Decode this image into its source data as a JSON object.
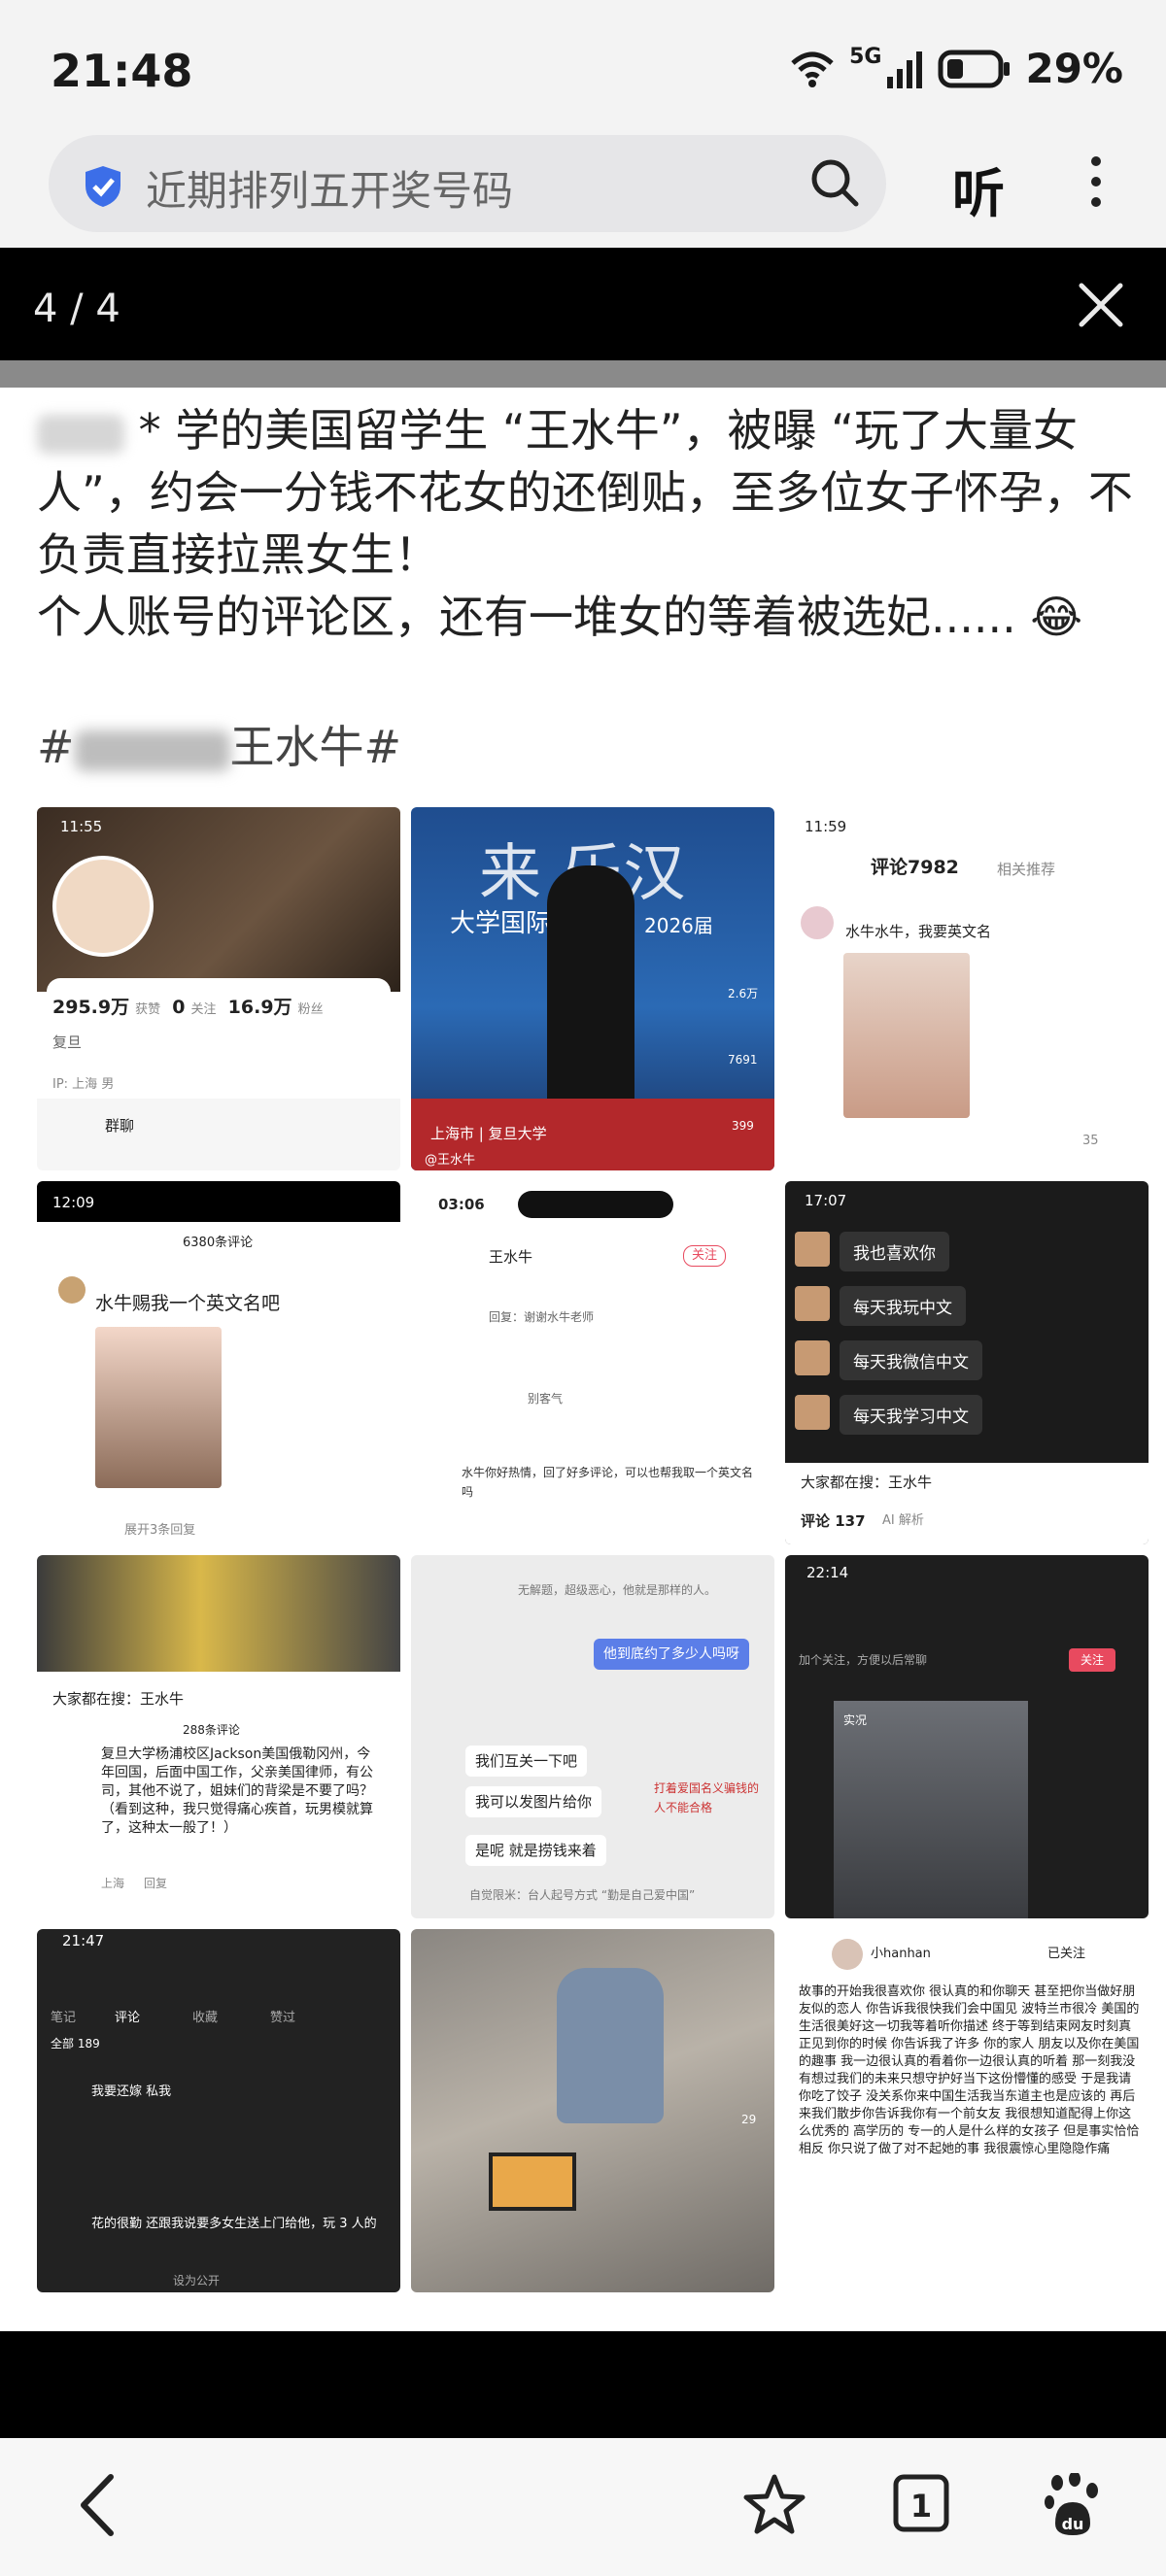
{
  "status_bar": {
    "time": "21:48",
    "network": "5G",
    "battery": "29%"
  },
  "search": {
    "query": "近期排列五开奖号码",
    "listen_label": "听"
  },
  "viewer": {
    "counter": "4 / 4"
  },
  "post": {
    "line1": "学的美国留学生 “王水牛”，被曝 “玩了大量女",
    "line2": "人”，约会一分钱不花女的还倒贴，至多位女子怀孕，不",
    "line3": "负责直接拉黑女生！",
    "line4": "个人账号的评论区，还有一堆女的等着被选妃...... 😂",
    "hashtag_start": "#",
    "hashtag_end": "王水牛#"
  },
  "thumbs": {
    "t1": {
      "time": "11:55",
      "followers": "295.9万",
      "followers_label": "获赞",
      "following": "0",
      "following_label": "关注",
      "fans": "16.9万",
      "fans_label": "粉丝",
      "school": "复旦",
      "location": "IP: 上海   男",
      "group": "群聊"
    },
    "t2": {
      "title": "大学国际文",
      "year": "2026届",
      "likes": "2.6万",
      "comments": "7691",
      "stars": "399",
      "location": "上海市 | 复旦大学",
      "author": "@王水牛"
    },
    "t3": {
      "time": "11:59",
      "tab_comments": "评论7982",
      "tab_related": "相关推荐",
      "comment": "水牛水牛，我要英文名",
      "likes": "35"
    },
    "t4": {
      "time": "12:09",
      "count": "6380条评论",
      "comment": "水牛赐我一个英文名吧",
      "expand": "展开3条回复"
    },
    "t5": {
      "time": "03:06",
      "name": "王水牛",
      "follow": "关注",
      "c1": "回复：谢谢水牛老师",
      "c2": "别客气",
      "c3": "水牛你好热情，回了好多评论，可以也帮我取一个英文名吗"
    },
    "t6": {
      "time": "17:07",
      "m1": "我也喜欢你",
      "m2": "每天我玩中文",
      "m3": "每天我微信中文",
      "m4": "每天我学习中文",
      "search": "大家都在搜：王水牛",
      "comments": "评论 137",
      "ai": "AI 解析"
    },
    "t7": {
      "search": "大家都在搜：王水牛",
      "count": "288条评论",
      "comment": "复旦大学杨浦校区Jackson美国俄勒冈州，今年回国，后面中国工作，父亲美国律师，有公司，其他不说了，姐妹们的背梁是不要了吗？（看到这种，我只觉得痛心疾首，玩男模就算了，这种太一般了！）",
      "loc": "上海",
      "reply": "回复"
    },
    "t8": {
      "q1": "无解题，超级恶心，他就是那样的人。",
      "me": "他到底约了多少人吗呀",
      "r1": "我们互关一下吧",
      "r2": "我可以发图片给你",
      "r3": "是呢 就是捞钱来着",
      "note": "打着爱国名义骗钱的人不能合格",
      "footer": "自觉限米：台人起号方式 “勤是自己爱中国”"
    },
    "t9": {
      "time": "22:14",
      "tip": "加个关注，方便以后常聊",
      "follow_btn": "关注",
      "tag": "实况"
    },
    "t10": {
      "time": "21:47",
      "tab1": "笔记",
      "tab2": "评论",
      "tab3": "收藏",
      "tab4": "赞过",
      "total": "全部 189",
      "c1": "我要还嫁 私我",
      "c2": "花的很勤 还跟我说要多女生送上门给他，玩 3 人的",
      "footer": "设为公开"
    },
    "t11": {
      "likes": "29"
    },
    "t12": {
      "user": "小hanhan",
      "followed": "已关注",
      "text": "故事的开始我很喜欢你 很认真的和你聊天 甚至把你当做好朋友似的恋人 你告诉我很快我们会中国见 波特兰市很冷 美国的生活很美好这一切我等着听你描述 终于等到结束网友时刻真正见到你的时候 你告诉我了许多 你的家人 朋友以及你在美国的趣事 我一边很认真的看着你一边很认真的听着 那一刻我没有想过我们的未来只想守护好当下这份懵懂的感受 于是我请你吃了饺子 没关系你来中国生活我当东道主也是应该的 再后来我们散步你告诉我你有一个前女友 我很想知道配得上你这么优秀的 高学历的 专一的人是什么样的女孩子 但是事实恰恰相反 你只说了做了对不起她的事 我很震惊心里隐隐作痛"
    }
  },
  "colors": {
    "accent": "#3c6ee8",
    "red": "#e84a5f"
  }
}
